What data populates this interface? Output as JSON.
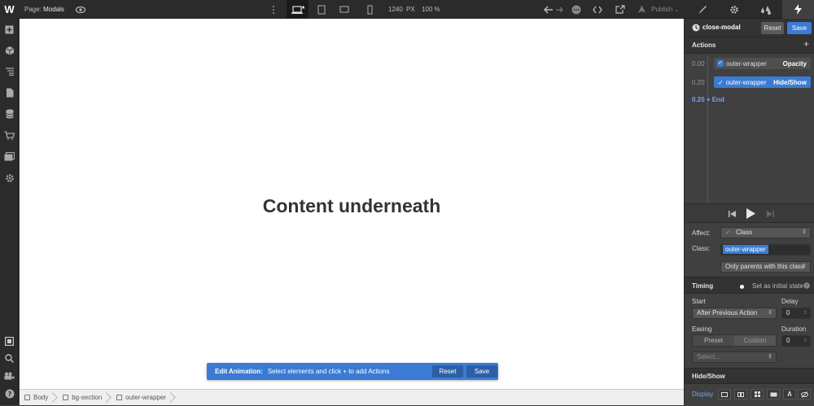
{
  "topbar": {
    "logo": "W",
    "page_label": "Page:",
    "page_name": "Modals",
    "width_value": "1240",
    "width_unit": "PX",
    "zoom": "100 %",
    "publish_label": "Publish"
  },
  "canvas": {
    "heading": "Content underneath",
    "anim_bar": {
      "label": "Edit Animation:",
      "message": "Select elements and click + to add Actions",
      "reset": "Reset",
      "save": "Save"
    }
  },
  "breadcrumb": [
    "Body",
    "bg-section",
    "outer-wrapper"
  ],
  "panel": {
    "interaction_name": "close-modal",
    "reset": "Reset",
    "save": "Save",
    "actions_title": "Actions",
    "actions": [
      {
        "time": "0.00",
        "target": "outer-wrapper",
        "type": "Opacity",
        "selected": false
      },
      {
        "time": "0.20",
        "target": "outer-wrapper",
        "type": "Hide/Show",
        "selected": true
      }
    ],
    "end_time": "0.20",
    "end_label": "End",
    "affect_label": "Affect:",
    "affect_value": "Class",
    "class_label": "Class:",
    "class_value": "outer-wrapper",
    "scope_value": "Only parents with this class",
    "timing_title": "Timing",
    "initial_state_label": "Set as initial state",
    "start_label": "Start",
    "start_value": "After Previous Action",
    "delay_label": "Delay",
    "delay_value": "0",
    "delay_unit": "s",
    "easing_label": "Easing",
    "easing_preset": "Preset",
    "easing_custom": "Custom",
    "easing_placeholder": "Select...",
    "duration_label": "Duration",
    "duration_value": "0",
    "duration_unit": "s",
    "hideshow_title": "Hide/Show",
    "display_label": "Display"
  },
  "colors": {
    "accent": "#3b7bd3",
    "topbar_bg": "#2b2b2b",
    "panel_bg": "#404040"
  }
}
